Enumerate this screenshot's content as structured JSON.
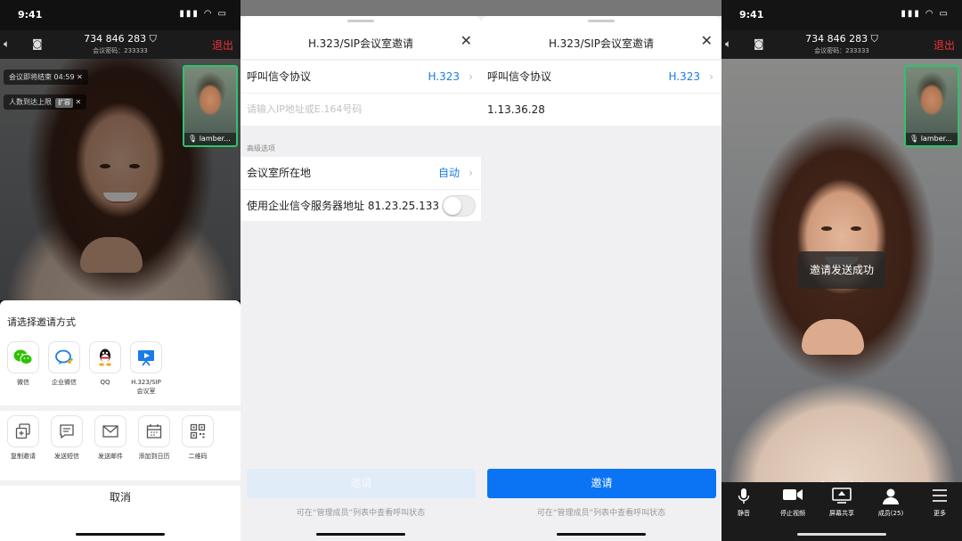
{
  "status": {
    "time": "9:41"
  },
  "meeting": {
    "id": "734 846 283",
    "password_label": "会议密码：233333",
    "exit": "退出",
    "notice_end": "会议即将结束 04:59",
    "notice_full": "人数到达上限",
    "notice_full_tag": "扩容",
    "participant_name": "lamber..."
  },
  "invite_sheet": {
    "title": "请选择邀请方式",
    "row1": [
      {
        "label": "微信",
        "icon": "wechat-icon"
      },
      {
        "label": "企业微信",
        "icon": "wecom-icon"
      },
      {
        "label": "QQ",
        "icon": "qq-icon"
      },
      {
        "label": "H.323/SIP\n会议室",
        "icon": "meeting-room-icon"
      }
    ],
    "row2": [
      {
        "label": "复制邀请",
        "icon": "copy-icon"
      },
      {
        "label": "发送短信",
        "icon": "sms-icon"
      },
      {
        "label": "发送邮件",
        "icon": "mail-icon"
      },
      {
        "label": "添加到日历",
        "icon": "calendar-icon"
      },
      {
        "label": "二维码",
        "icon": "qrcode-icon"
      }
    ],
    "cancel": "取消"
  },
  "sip_form": {
    "title": "H.323/SIP会议室邀请",
    "protocol_label": "呼叫信令协议",
    "protocol_value": "H.323",
    "address_placeholder": "请输入IP地址或E.164号码",
    "advanced_label": "高级选项",
    "location_label": "会议室所在地",
    "location_value": "自动",
    "enterprise_label": "使用企业信令服务器地址",
    "enterprise_value": "81.23.25.133",
    "invite_button": "邀请",
    "hint": "可在“管理成员”列表中查看呼叫状态"
  },
  "sip_form_filled": {
    "title": "H.323/SIP会议室邀请",
    "protocol_label": "呼叫信令协议",
    "protocol_value": "H.323",
    "address_value": "1.13.36.28",
    "invite_button": "邀请",
    "hint": "可在“管理成员”列表中查看呼叫状态"
  },
  "toast": "邀请发送成功",
  "toolbar": [
    {
      "label": "静音",
      "icon": "mic-icon"
    },
    {
      "label": "停止视频",
      "icon": "video-icon"
    },
    {
      "label": "屏幕共享",
      "icon": "screen-share-icon"
    },
    {
      "label": "成员(25)",
      "icon": "members-icon"
    },
    {
      "label": "更多",
      "icon": "more-icon"
    }
  ],
  "colors": {
    "accent": "#0a74f5",
    "accent_disabled": "#b7d4f7",
    "exit_red": "#e33333",
    "active_border": "#2ec36b"
  }
}
